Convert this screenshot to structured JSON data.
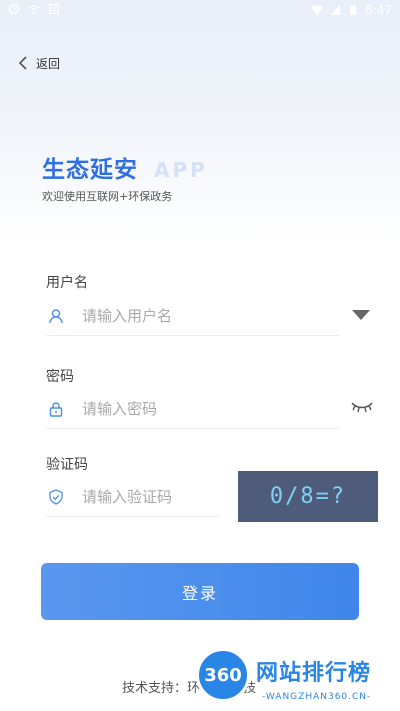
{
  "status_bar": {
    "time": "8:47"
  },
  "nav": {
    "back_label": "返回"
  },
  "header": {
    "title": "生态延安",
    "title_suffix": "APP",
    "subtitle": "欢迎使用互联网+环保政务"
  },
  "form": {
    "username": {
      "label": "用户名",
      "placeholder": "请输入用户名",
      "value": ""
    },
    "password": {
      "label": "密码",
      "placeholder": "请输入密码",
      "value": ""
    },
    "captcha": {
      "label": "验证码",
      "placeholder": "请输入验证码",
      "value": "",
      "image_text": "0/8=?"
    }
  },
  "login_button": "登录",
  "footer": {
    "support_text": "技术支持：环   星辉科技"
  },
  "watermark": {
    "logo_text": "360",
    "site_name": "网站排行榜",
    "url": "-WANGZHAN360.CN-"
  },
  "colors": {
    "accent": "#2f6fe2",
    "button": "#4a8fec",
    "captcha_bg": "#4e5b7b",
    "captcha_text": "#7fd0f5"
  },
  "icons": [
    "back-chevron-icon",
    "user-icon",
    "dropdown-triangle-icon",
    "lock-icon",
    "eye-closed-icon",
    "shield-check-icon"
  ]
}
